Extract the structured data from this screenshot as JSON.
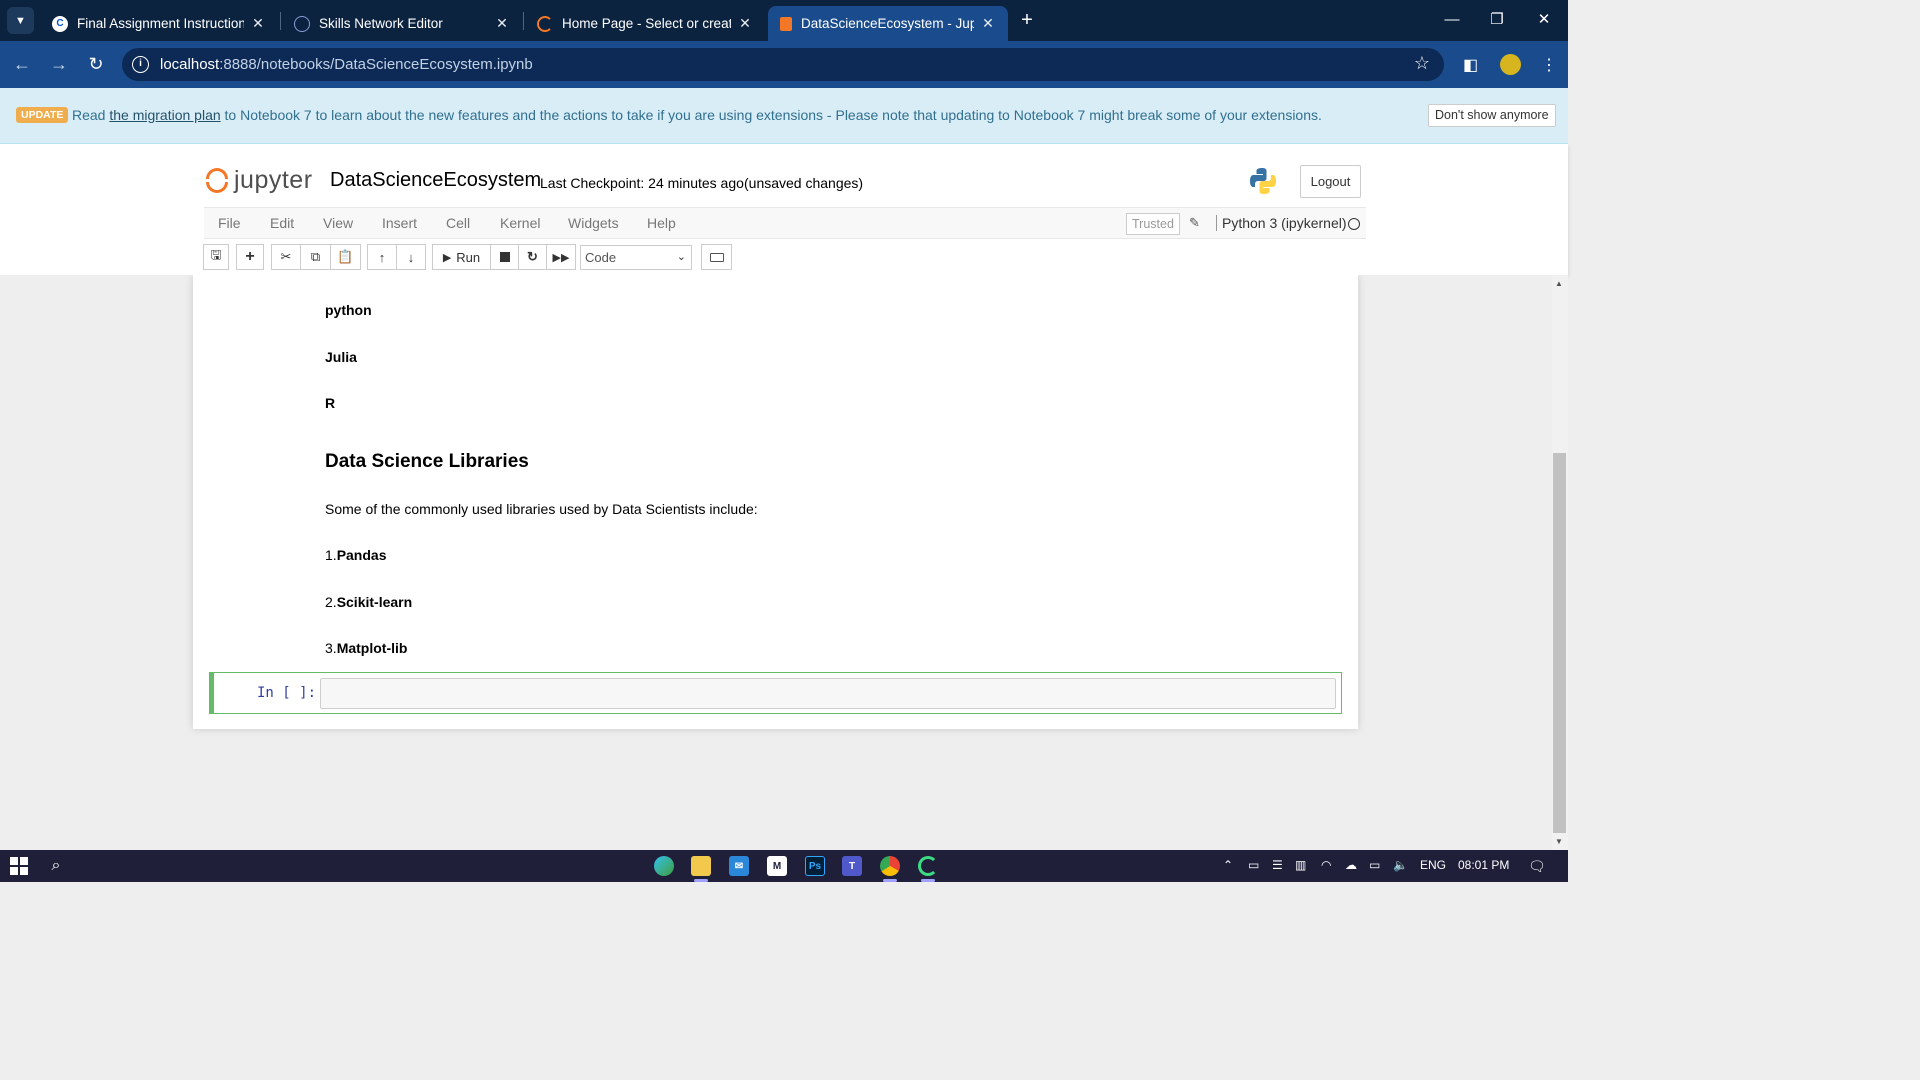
{
  "browser": {
    "tabs": [
      {
        "title": "Final Assignment Instructions: C",
        "favicon": "coursera-icon",
        "active": false
      },
      {
        "title": "Skills Network Editor",
        "favicon": "skills-network-icon",
        "active": false
      },
      {
        "title": "Home Page - Select or create a",
        "favicon": "jupyter-icon",
        "active": false
      },
      {
        "title": "DataScienceEcosystem - Jupyte",
        "favicon": "notebook-icon",
        "active": true
      }
    ],
    "url_host": "localhost",
    "url_rest": ":8888/notebooks/DataScienceEcosystem.ipynb"
  },
  "banner": {
    "badge": "UPDATE",
    "text_before": "Read ",
    "link": "the migration plan",
    "text_after": " to Notebook 7 to learn about the new features and the actions to take if you are using extensions - Please note that updating to Notebook 7 might break some of your extensions.",
    "dismiss": "Don't show anymore"
  },
  "jupyter": {
    "logo_text": "jupyter",
    "notebook_name": "DataScienceEcosystem",
    "checkpoint": "Last Checkpoint: 24 minutes ago",
    "autosave": "(unsaved changes)",
    "logout": "Logout",
    "menu": [
      "File",
      "Edit",
      "View",
      "Insert",
      "Cell",
      "Kernel",
      "Widgets",
      "Help"
    ],
    "trusted": "Trusted",
    "kernel": "Python 3 (ipykernel)",
    "run_label": "Run",
    "cell_type": "Code"
  },
  "notebook": {
    "languages": [
      "python",
      "Julia",
      "R"
    ],
    "libraries_heading": "Data Science Libraries",
    "libraries_intro": "Some of the commonly used libraries used by Data Scientists include:",
    "libraries": [
      {
        "num": "1.",
        "name": "Pandas"
      },
      {
        "num": "2.",
        "name": "Scikit-learn"
      },
      {
        "num": "3.",
        "name": "Matplot-lib"
      }
    ],
    "prompt": "In [ ]:"
  },
  "taskbar": {
    "language": "ENG",
    "time": "08:01 PM"
  },
  "colors": {
    "chrome_dark": "#0c2340",
    "chrome_accent": "#1a4b8c",
    "jupyter_orange": "#f37726",
    "cell_selected": "#66bb6a"
  }
}
